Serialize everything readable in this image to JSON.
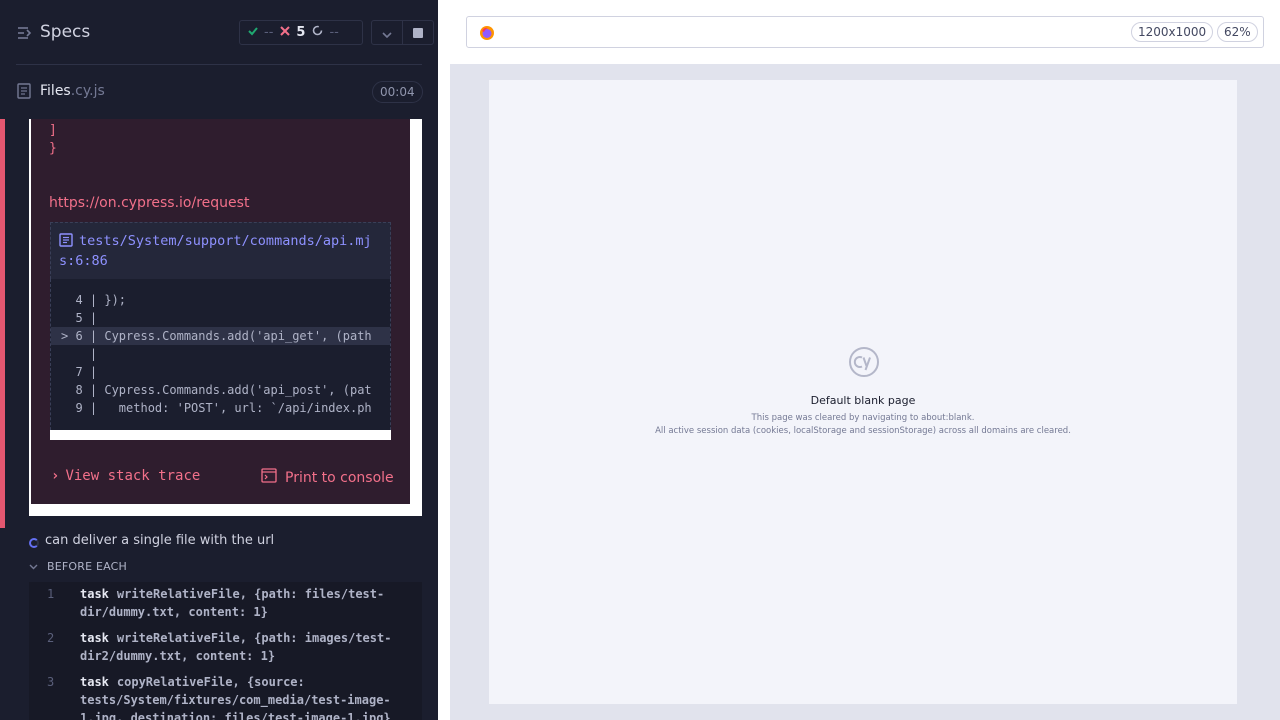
{
  "header": {
    "specs_label": "Specs",
    "stats": {
      "passed": "--",
      "failed": "5",
      "pending": "--"
    }
  },
  "spec": {
    "file_name": "Files",
    "file_ext": ".cy.js",
    "duration": "00:04"
  },
  "error": {
    "code_tail": [
      "]",
      "}"
    ],
    "doc_link": "https://on.cypress.io/request",
    "stack_file": "tests/System/support/commands/api.mjs:6:86",
    "code_frame": [
      "  4 | });",
      "  5 |",
      "> 6 | Cypress.Commands.add('api_get', (path",
      "    |",
      "  7 |",
      "  8 | Cypress.Commands.add('api_post', (pat",
      "  9 |   method: 'POST', url: `/api/index.ph"
    ],
    "view_stack_trace": "View stack trace",
    "print_to_console": "Print to console"
  },
  "test": {
    "title": "can deliver a single file with the url",
    "hook_label": "BEFORE EACH",
    "commands": [
      {
        "num": "1",
        "name": "task",
        "message": "writeRelativeFile, {path: files/test-dir/dummy.txt, content: 1}"
      },
      {
        "num": "2",
        "name": "task",
        "message": "writeRelativeFile, {path: images/test-dir2/dummy.txt, content: 1}"
      },
      {
        "num": "3",
        "name": "task",
        "message": "copyRelativeFile, {source: tests/System/fixtures/com_media/test-image-1.jpg, destination: files/test-image-1.jpg}"
      }
    ]
  },
  "aut": {
    "viewport": "1200x1000",
    "zoom": "62%",
    "blank_title": "Default blank page",
    "blank_line1": "This page was cleared by navigating to about:blank.",
    "blank_line2": "All active session data (cookies, localStorage and sessionStorage) across all domains are cleared."
  },
  "colors": {
    "reporter_bg": "#1b1e2e",
    "error_red": "#f2708a",
    "fail_stripe": "#e45770",
    "link_indigo": "#8e91ff",
    "pass_green": "#1fa971"
  },
  "icons": [
    "specs-list-icon",
    "check-icon",
    "x-icon",
    "pending-icon",
    "chevron-down-icon",
    "stop-icon",
    "document-icon",
    "chevron-right-icon",
    "terminal-icon",
    "firefox-icon",
    "cypress-logo"
  ]
}
